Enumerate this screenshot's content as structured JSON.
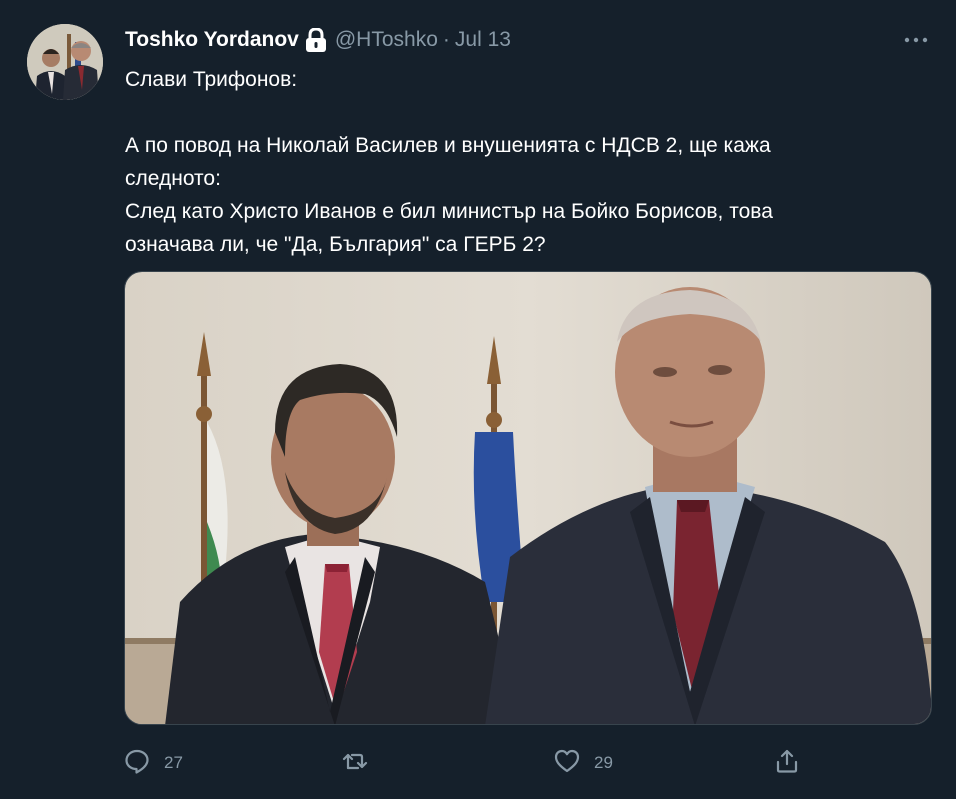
{
  "tweet": {
    "author": {
      "display_name": "Toshko Yordanov",
      "handle": "@HToshko",
      "protected_icon": "lock-icon",
      "avatar_icon": "avatar"
    },
    "separator": "·",
    "date": "Jul 13",
    "more_icon": "more-icon",
    "text_lines": {
      "l1": "Слави Трифонов:",
      "l2": "А по повод на Николай Василев и внушенията с НДСВ 2, ще кажа",
      "l3": "следното:",
      "l4": "След като Христо Иванов е бил министър на Бойко Борисов, това",
      "l5": "означава ли, че \"Да, България\" са ГЕРБ 2?"
    },
    "media": {
      "type": "photo"
    },
    "actions": {
      "reply": {
        "icon": "reply-icon",
        "count": "27"
      },
      "retweet": {
        "icon": "retweet-icon",
        "count": ""
      },
      "like": {
        "icon": "heart-icon",
        "count": "29"
      },
      "share": {
        "icon": "share-icon"
      }
    }
  },
  "colors": {
    "background": "#15202b",
    "text": "#ffffff",
    "secondary_text": "#8899a6",
    "border": "#38444d"
  }
}
